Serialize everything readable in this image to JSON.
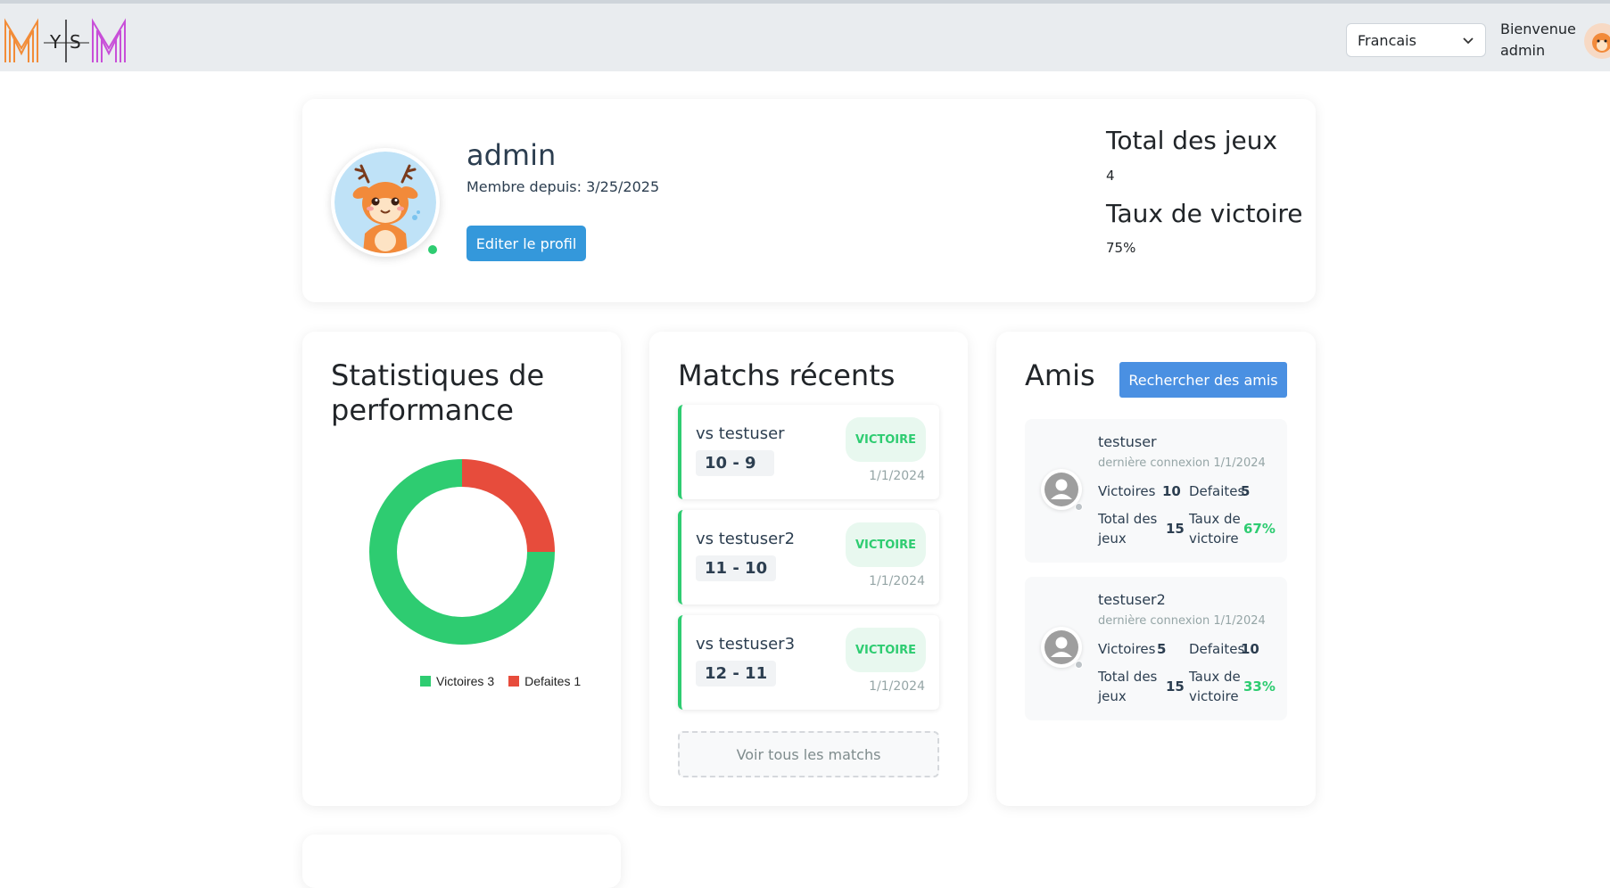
{
  "header": {
    "logo_text": "MYSM",
    "language": "Francais",
    "welcome_line1": "Bienvenue",
    "welcome_line2": "admin"
  },
  "profile": {
    "name": "admin",
    "member_since": "Membre depuis: 3/25/2025",
    "edit_label": "Editer le profil",
    "total_games_label": "Total des jeux",
    "total_games_value": "4",
    "win_rate_label": "Taux de victoire",
    "win_rate_value": "75%"
  },
  "performance": {
    "title": "Statistiques de performance"
  },
  "chart_data": {
    "type": "pie",
    "categories": [
      "Victoires",
      "Defaites"
    ],
    "values": [
      3,
      1
    ],
    "colors": [
      "#2ecc71",
      "#e74c3c"
    ],
    "legend": [
      "Victoires 3",
      "Defaites 1"
    ],
    "legend_position": "bottom"
  },
  "matches": {
    "title": "Matchs récents",
    "items": [
      {
        "opponent": "vs testuser",
        "score": "10 - 9",
        "result": "VICTOIRE",
        "date": "1/1/2024"
      },
      {
        "opponent": "vs testuser2",
        "score": "11 - 10",
        "result": "VICTOIRE",
        "date": "1/1/2024"
      },
      {
        "opponent": "vs testuser3",
        "score": "12 - 11",
        "result": "VICTOIRE",
        "date": "1/1/2024"
      }
    ],
    "view_all": "Voir tous les matchs"
  },
  "friends": {
    "title": "Amis",
    "search_label": "Rechercher des amis",
    "labels": {
      "wins": "Victoires",
      "losses": "Defaites",
      "total_l1": "Total des",
      "total_l2": "jeux",
      "rate_l1": "Taux de",
      "rate_l2": "victoire"
    },
    "items": [
      {
        "name": "testuser",
        "last_login": "dernière connexion 1/1/2024",
        "wins": "10",
        "losses": "5",
        "total": "15",
        "rate": "67%"
      },
      {
        "name": "testuser2",
        "last_login": "dernière connexion 1/1/2024",
        "wins": "5",
        "losses": "10",
        "total": "15",
        "rate": "33%"
      }
    ]
  },
  "colors": {
    "win": "#2ecc71",
    "loss": "#e74c3c",
    "primary": "#3498db",
    "header_bg": "#e9ecef"
  }
}
